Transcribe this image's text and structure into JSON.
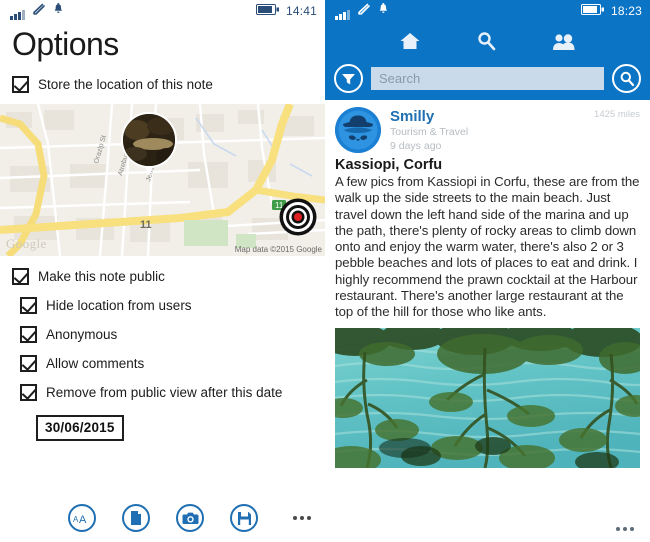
{
  "left": {
    "status": {
      "signal_icon": "signal-bars-icon",
      "wifi_icon": "wifi-icon",
      "bell_icon": "bell-icon",
      "battery_icon": "battery-icon",
      "time": "14:41"
    },
    "title": "Options",
    "primary_check": {
      "label": "Store the location of this note",
      "checked": true
    },
    "map": {
      "pin_icon": "map-pin-icon",
      "target_icon": "target-crosshair-icon",
      "logo": "Google",
      "attribution": "Map data ©2015 Google",
      "streets": [
        "Orazlp St",
        "Atrebus St",
        "Jema St",
        "11"
      ]
    },
    "options": [
      {
        "label": "Make this note public",
        "checked": true,
        "indent": false
      },
      {
        "label": "Hide location from users",
        "checked": true,
        "indent": true
      },
      {
        "label": "Anonymous",
        "checked": true,
        "indent": true
      },
      {
        "label": "Allow comments",
        "checked": true,
        "indent": true
      },
      {
        "label": "Remove from public view after this date",
        "checked": true,
        "indent": true
      }
    ],
    "date_value": "30/06/2015",
    "appbar": {
      "font_size_icon": "font-size-aa-icon",
      "document_icon": "document-icon",
      "camera_icon": "camera-icon",
      "save_icon": "save-floppy-icon",
      "more_icon": "more-ellipsis-icon"
    }
  },
  "right": {
    "status": {
      "signal_icon": "signal-bars-icon",
      "wifi_icon": "wifi-icon",
      "bell_icon": "bell-icon",
      "battery_icon": "battery-icon",
      "time": "18:23"
    },
    "nav": [
      {
        "name": "home",
        "icon": "home-icon"
      },
      {
        "name": "search",
        "icon": "magnifier-icon"
      },
      {
        "name": "people",
        "icon": "people-icon"
      }
    ],
    "search": {
      "filter_icon": "filter-funnel-icon",
      "placeholder": "Search",
      "value": "",
      "submit_icon": "search-magnifier-icon"
    },
    "post": {
      "avatar_icon": "incognito-avatar-icon",
      "user": "Smilly",
      "category": "Tourism & Travel",
      "time_ago": "9 days ago",
      "distance": "1425 miles",
      "title": "Kassiopi, Corfu",
      "body": "A few pics from Kassiopi in Corfu, these are from the walk up the side streets to the main beach.  Just travel down the left hand side of the marina and up the path, there's plenty of rocky areas to climb down onto and enjoy the warm water, there's also 2 or 3 pebble beaches and lots of places to eat and drink.  I highly recommend the prawn cocktail at the Harbour restaurant.  There's another large restaurant at the top of the hill for those who like ants.",
      "photo_alt": "sea-through-trees-photo"
    },
    "more_icon": "more-ellipsis-icon"
  },
  "colors": {
    "header_blue": "#0c74c4",
    "accent_blue": "#1f6fb2",
    "search_field": "#c9daea",
    "text_dark": "#1a1a1a"
  }
}
